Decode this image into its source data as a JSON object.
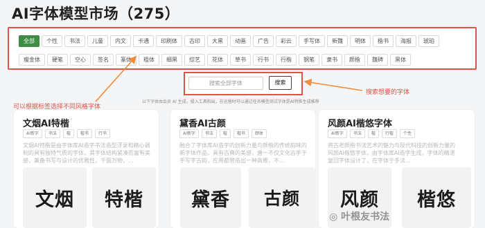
{
  "header": {
    "title": "AI字体模型市场（275）"
  },
  "tags": {
    "row1": [
      "全部",
      "个性",
      "书法",
      "儿童",
      "内文",
      "卡通",
      "印刷体",
      "古印",
      "大黑",
      "动画",
      "广告",
      "彩云",
      "手写体",
      "新魏",
      "明体",
      "楷书",
      "海报",
      "琥珀"
    ],
    "row2": [
      "瘦金体",
      "硬笔",
      "空心",
      "签名",
      "篆体",
      "粗体",
      "细黑",
      "综艺",
      "花体",
      "草书",
      "行书",
      "行楷",
      "钢笔",
      "隶书",
      "颜楷",
      "魏碑",
      "黑体"
    ],
    "active": "全部"
  },
  "search": {
    "placeholder": "搜索全部字体",
    "button_label": "搜索"
  },
  "note": "以下字体由会员 AI 生成，侵入工具阳出，在运营时可以通过任务模型测试字体是AI特殊生成推荐",
  "annotations": {
    "left": "可以根据标签选择不同风格字体",
    "right": "搜索想要的字体",
    "color": "#e05248"
  },
  "cards": [
    {
      "title": "文烟AI特楷",
      "tags": [
        "AI新字",
        "书法",
        "楷",
        "楷书",
        "行书"
      ],
      "description": "文烟AI特楷是由字体库AI造字书法造型浮录和精心调制的具有独特气质的字体，其字体结构紧凑而富有美感，兼备书写与设计的优雅性，千面万物，...",
      "preview_left": "文烟",
      "preview_right": "特楷"
    },
    {
      "title": "黛香AI古颜",
      "tags": [
        "AI新字",
        "书法",
        "楷",
        "楷书",
        "颜体"
      ],
      "description": "融合了字体库AI造字的创新力量与颜楷的传统韵味的新字体作品，具有古典的美感，唐一不仅文化古手于手写字古韵，应用都营造出一种高雅，不...",
      "preview_left": "黛香",
      "preview_right": "古颜"
    },
    {
      "title": "风颜AI楷悠字体",
      "tags": [
        "AI新字",
        "书法",
        "楷",
        "行楷",
        "个性"
      ],
      "description": "将古老颜楷书法艺术的魅力与现代科技的创新力量的风颜AI楷悠字体，由字体库AI造字生成，字体的精湛复回字体设计了，在字体于手法...",
      "preview_left": "风颜",
      "preview_right": "楷悠"
    }
  ],
  "watermark": "叶根友书法"
}
